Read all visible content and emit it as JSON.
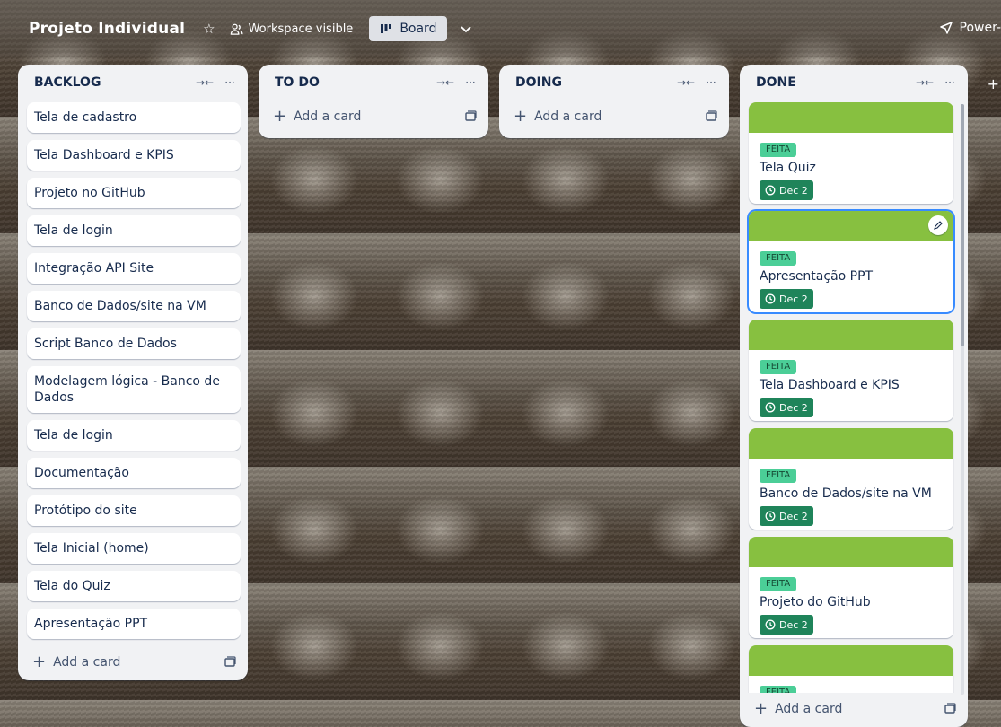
{
  "header": {
    "board_title": "Projeto Individual",
    "visibility": "Workspace visible",
    "view_label": "Board",
    "powerups": "Power-"
  },
  "lists": {
    "backlog": {
      "title": "BACKLOG",
      "cards": [
        "Tela de cadastro",
        "Tela Dashboard e KPIS",
        "Projeto no GitHub",
        "Tela de login",
        "Integração API Site",
        "Banco de Dados/site na VM",
        "Script Banco de Dados",
        "Modelagem lógica - Banco de Dados",
        "Tela de login",
        "Documentação",
        "Protótipo do site",
        "Tela Inicial (home)",
        "Tela do Quiz",
        "Apresentação PPT"
      ],
      "add_label": "Add a card"
    },
    "todo": {
      "title": "TO DO",
      "add_label": "Add a card"
    },
    "doing": {
      "title": "DOING",
      "add_label": "Add a card"
    },
    "done": {
      "title": "DONE",
      "add_label": "Add a card",
      "cover_color": "#87c040",
      "label_color": "#4bce97",
      "due_color": "#1f845a",
      "cards": [
        {
          "label": "FEITA",
          "title": "Tela Quiz",
          "due": "Dec 2"
        },
        {
          "label": "FEITA",
          "title": "Apresentação PPT",
          "due": "Dec 2"
        },
        {
          "label": "FEITA",
          "title": "Tela Dashboard e KPIS",
          "due": "Dec 2"
        },
        {
          "label": "FEITA",
          "title": "Banco de Dados/site na VM",
          "due": "Dec 2"
        },
        {
          "label": "FEITA",
          "title": "Projeto do GitHub",
          "due": "Dec 2"
        },
        {
          "label": "FEITA",
          "title": "",
          "due": ""
        }
      ]
    }
  }
}
